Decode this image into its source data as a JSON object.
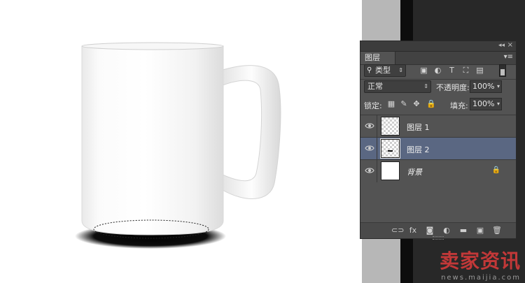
{
  "panel": {
    "tab_label": "图层",
    "filter": {
      "selected": "类型"
    },
    "blend_mode": "正常",
    "opacity_label": "不透明度:",
    "opacity_value": "100%",
    "lock_label": "锁定:",
    "fill_label": "填充:",
    "fill_value": "100%",
    "layers": [
      {
        "name": "图层 1",
        "thumbnail": "transparent",
        "visible": true,
        "selected": false
      },
      {
        "name": "图层 2",
        "thumbnail": "transparent-with-mark",
        "visible": true,
        "selected": true
      },
      {
        "name": "背景",
        "thumbnail": "white",
        "visible": true,
        "selected": false,
        "locked": true
      }
    ],
    "colors": {
      "panel_bg": "#535353",
      "selected_row": "#5a6782"
    }
  },
  "watermark": {
    "logo": "卖家资讯",
    "url": "news.maijia.com"
  }
}
